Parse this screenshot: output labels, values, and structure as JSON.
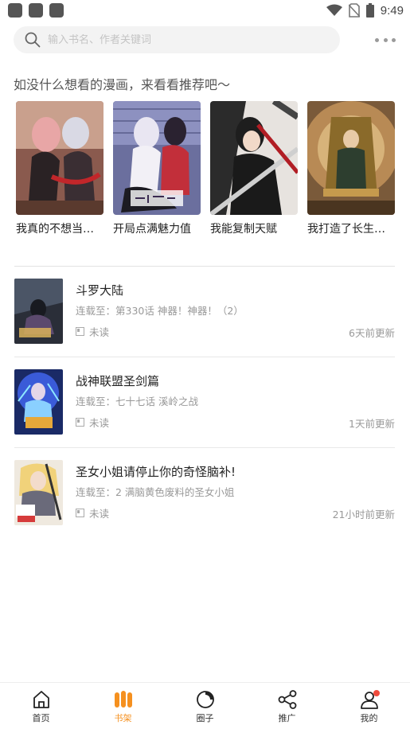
{
  "status_bar": {
    "time": "9:49"
  },
  "search": {
    "placeholder": "输入书名、作者关键词"
  },
  "recommend": {
    "heading": "如没什么想看的漫画，来看看推荐吧～",
    "items": [
      {
        "title": "我真的不想当第一仙尊"
      },
      {
        "title": "开局点满魅力值"
      },
      {
        "title": "我能复制天赋"
      },
      {
        "title": "我打造了长生俱乐部"
      }
    ]
  },
  "shelf": {
    "items": [
      {
        "title": "斗罗大陆",
        "latest": "连载至：第330话 神器！神器！（2）",
        "read_status": "未读",
        "updated": "6天前更新"
      },
      {
        "title": "战神联盟圣剑篇",
        "latest": "连载至：七十七话 溪岭之战",
        "read_status": "未读",
        "updated": "1天前更新"
      },
      {
        "title": "圣女小姐请停止你的奇怪脑补!",
        "latest": "连载至：2 满脑黄色废料的圣女小姐",
        "read_status": "未读",
        "updated": "21小时前更新"
      }
    ]
  },
  "nav": {
    "items": [
      {
        "label": "首页"
      },
      {
        "label": "书架"
      },
      {
        "label": "圈子"
      },
      {
        "label": "推广"
      },
      {
        "label": "我的"
      }
    ],
    "active": "书架"
  },
  "colors": {
    "accent": "#f5901f",
    "badge": "#f04b3c",
    "text_muted": "#999999"
  }
}
